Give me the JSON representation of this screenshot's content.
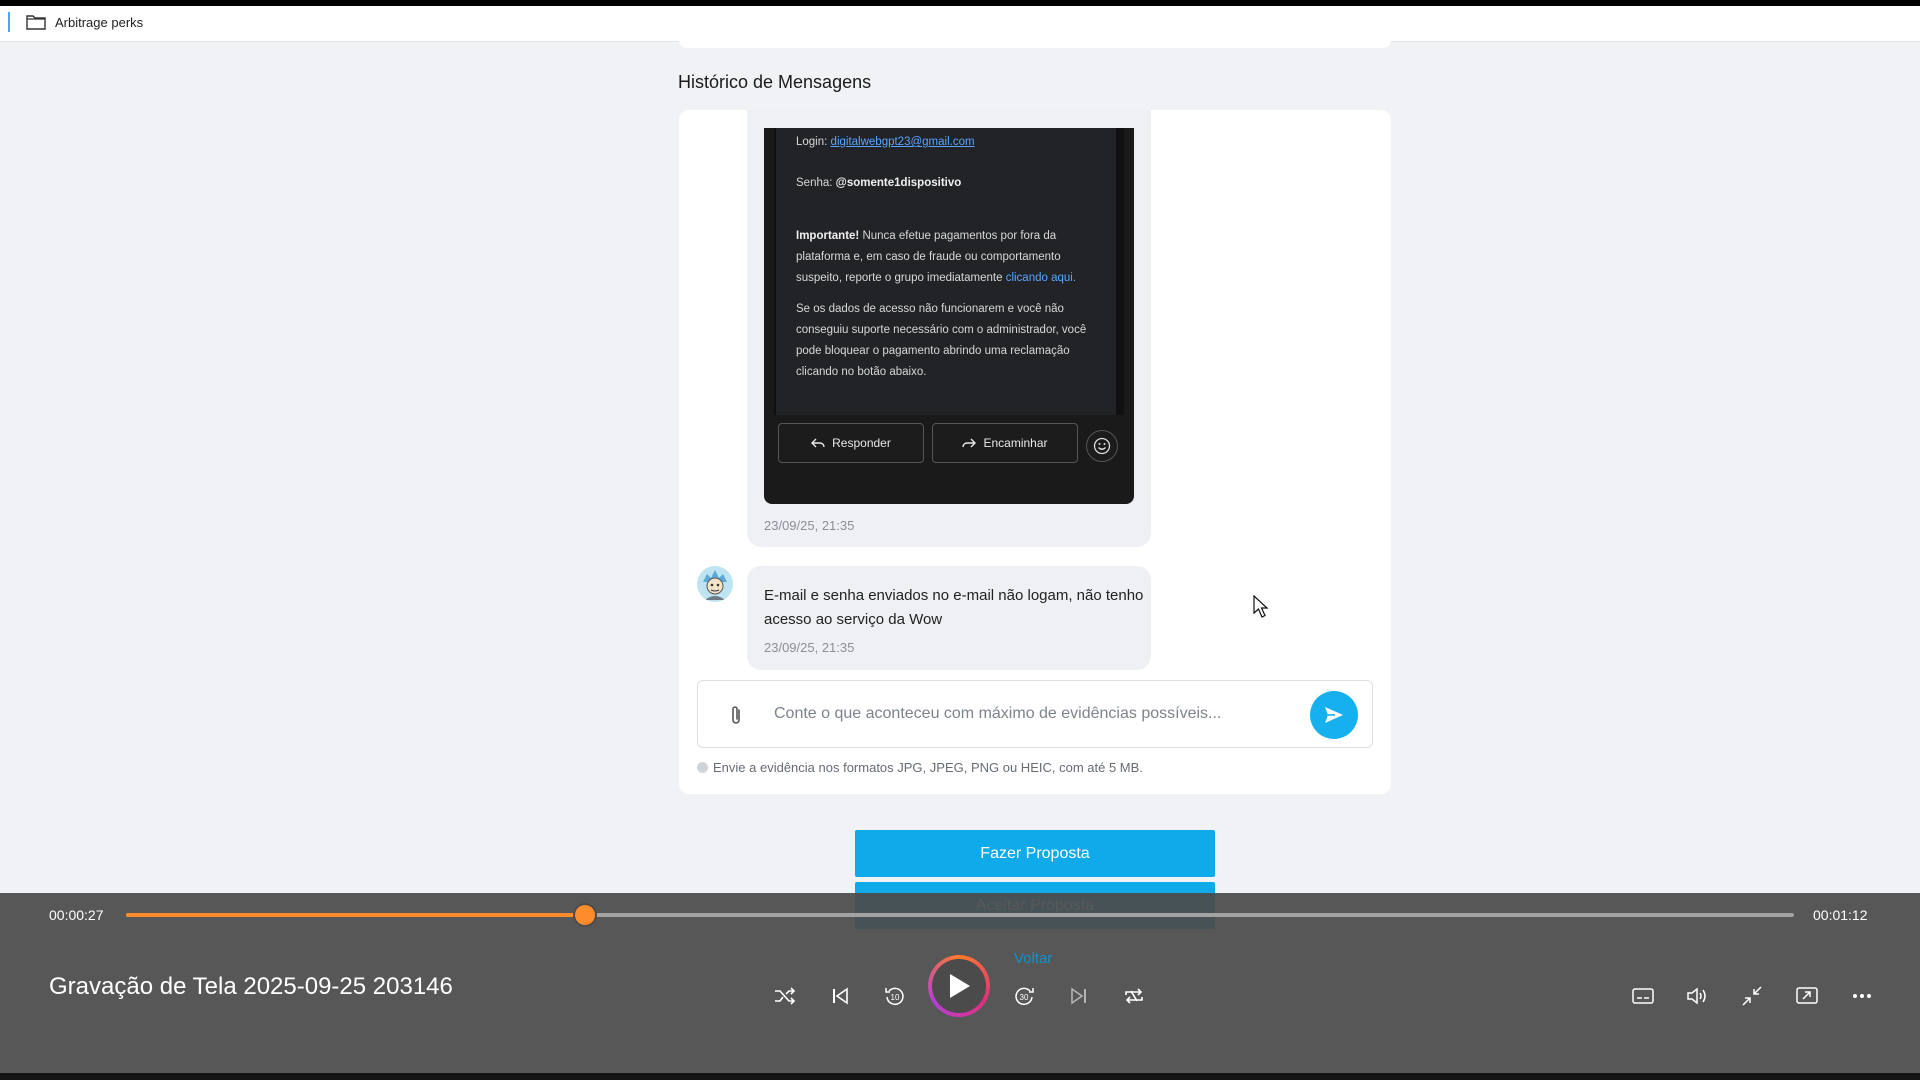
{
  "topbar": {
    "folder_label": "Arbitrage perks"
  },
  "messages": {
    "section_title": "Histórico de Mensagens",
    "screenshot": {
      "login_label": "Login:",
      "login_email": "digitalwebgpt23@gmail.com",
      "password_label": "Senha:",
      "password_value": "@somente1dispositivo",
      "important_label": "Importante!",
      "important_text": "Nunca efetue pagamentos por fora da plataforma e, em caso de fraude ou comportamento suspeito, reporte o grupo imediatamente",
      "important_link": "clicando aqui.",
      "access_text": "Se os dados de acesso não funcionarem e você não conseguiu suporte necessário com o administrador, você pode bloquear o pagamento abrindo uma reclamação clicando no botão abaixo.",
      "reply_button": "Responder",
      "forward_button": "Encaminhar",
      "emoji_icon": "smile-icon"
    },
    "timestamp_1": "23/09/25, 21:35",
    "message_2_text": "E-mail e senha enviados no e-mail  não logam, não tenho acesso ao serviço da Wow",
    "timestamp_2": "23/09/25, 21:35"
  },
  "composer": {
    "placeholder": "Conte o que aconteceu com máximo de evidências possíveis...",
    "value": "",
    "attach_icon": "paperclip-icon",
    "send_icon": "send-icon",
    "hint": "Envie a evidência nos formatos JPG, JPEG, PNG ou HEIC, com até 5 MB."
  },
  "actions": {
    "make_offer": "Fazer Proposta",
    "accept_offer": "Aceitar Proposta",
    "back": "Voltar"
  },
  "player": {
    "current_time": "00:00:27",
    "total_time": "00:01:12",
    "progress_fraction": 0.275,
    "title": "Gravação de Tela 2025-09-25 203146",
    "accent_color": "#ff8c2a",
    "icons": [
      "shuffle-icon",
      "previous-icon",
      "rewind-10-icon",
      "play-icon",
      "forward-30-icon",
      "next-icon",
      "repeat-icon",
      "subtitles-icon",
      "volume-icon",
      "minimize-icon",
      "cast-icon",
      "more-icon"
    ]
  }
}
